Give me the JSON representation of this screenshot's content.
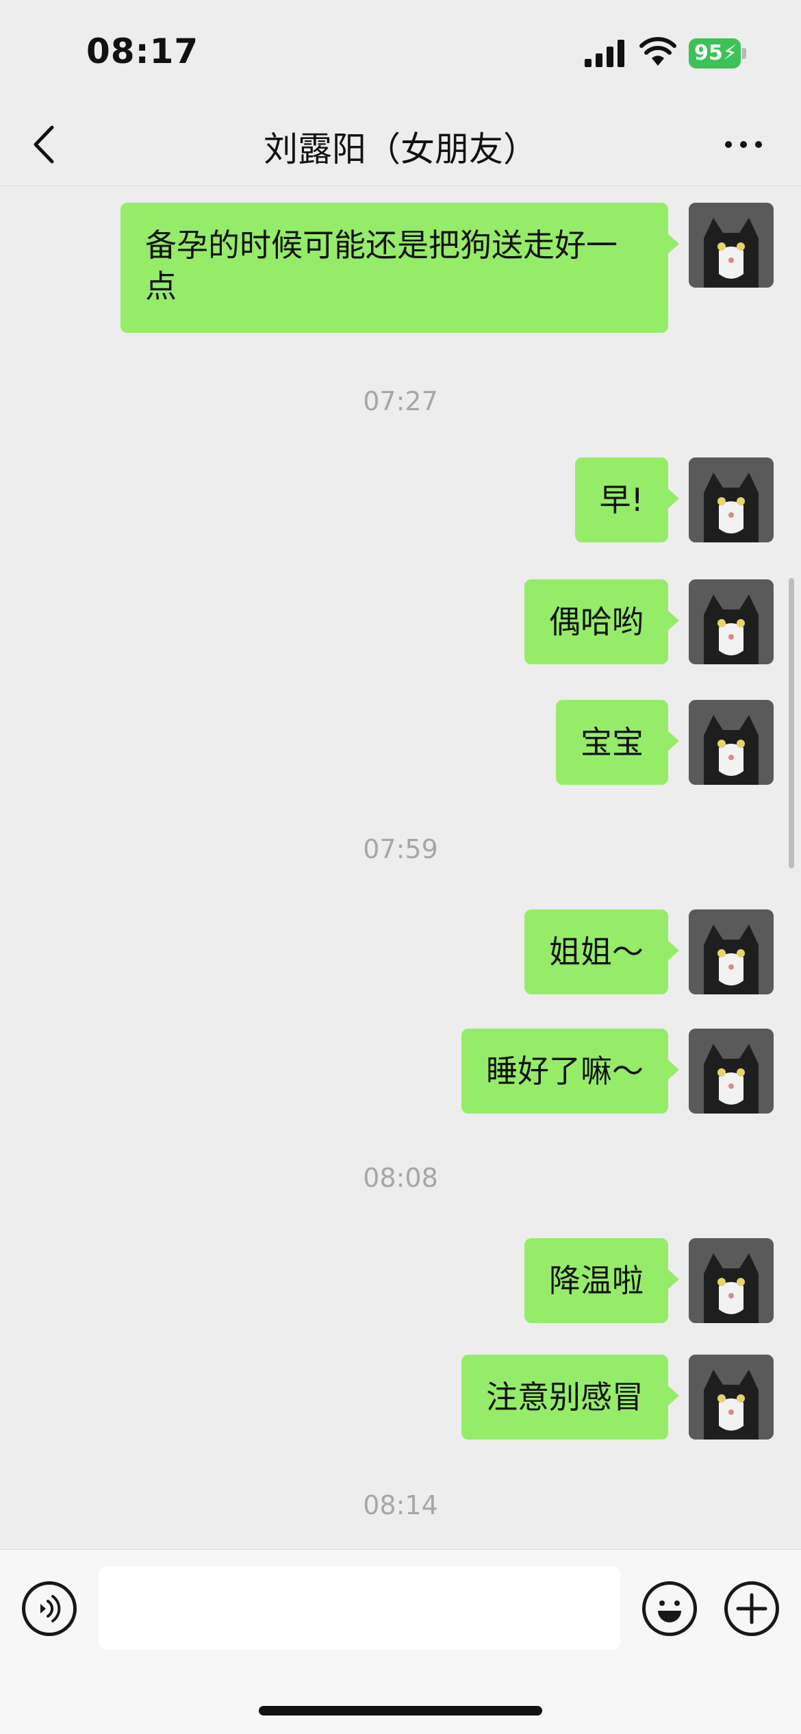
{
  "status_bar": {
    "time": "08:17",
    "battery": "95",
    "icons": [
      "signal-icon",
      "wifi-icon",
      "battery-icon"
    ]
  },
  "header": {
    "title": "刘露阳（女朋友）",
    "back_icon": "chevron-left-icon",
    "more_icon": "ellipsis-icon"
  },
  "messages": [
    {
      "type": "message",
      "sender": "me",
      "text": "备孕的时候可能还是把狗送走好一点"
    },
    {
      "type": "time",
      "text": "07:27"
    },
    {
      "type": "message",
      "sender": "me",
      "text": "早!"
    },
    {
      "type": "message",
      "sender": "me",
      "text": "偶哈哟"
    },
    {
      "type": "message",
      "sender": "me",
      "text": "宝宝"
    },
    {
      "type": "time",
      "text": "07:59"
    },
    {
      "type": "message",
      "sender": "me",
      "text": "姐姐～"
    },
    {
      "type": "message",
      "sender": "me",
      "text": "睡好了嘛～"
    },
    {
      "type": "time",
      "text": "08:08"
    },
    {
      "type": "message",
      "sender": "me",
      "text": "降温啦"
    },
    {
      "type": "message",
      "sender": "me",
      "text": "注意别感冒"
    },
    {
      "type": "time",
      "text": "08:14"
    }
  ],
  "input_bar": {
    "value": "",
    "icons": [
      "voice-icon",
      "emoji-icon",
      "plus-icon"
    ]
  },
  "colors": {
    "bubble": "#95ec69",
    "background": "#ededed",
    "timestamp": "#a6a6a6"
  }
}
